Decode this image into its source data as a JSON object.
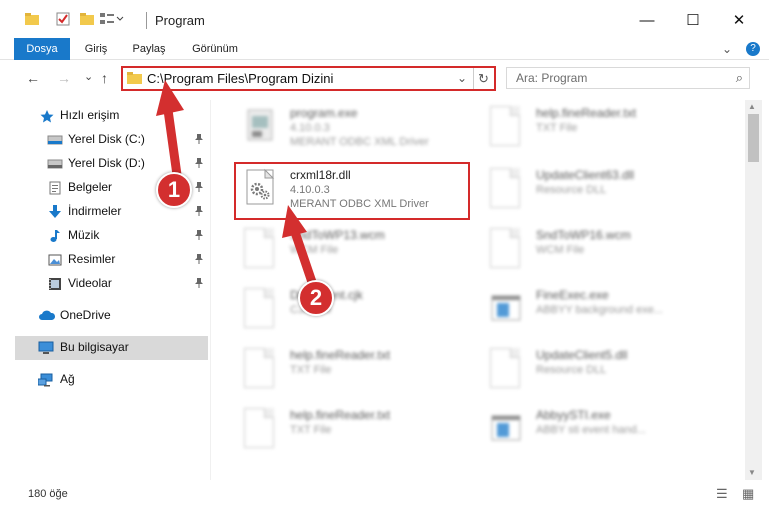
{
  "window": {
    "title": "Program",
    "minimize": "—",
    "maximize": "☐",
    "close": "✕"
  },
  "ribbon": {
    "tabs": [
      "Dosya",
      "Giriş",
      "Paylaş",
      "Görünüm"
    ],
    "expand": "⌄",
    "help": "?"
  },
  "nav": {
    "back": "←",
    "forward": "→",
    "recent": "⌄",
    "up": "↑"
  },
  "address": {
    "path": "C:\\Program Files\\Program Dizini",
    "dropdown": "⌄",
    "refresh": "↻"
  },
  "search": {
    "placeholder": "Ara: Program",
    "icon": "⌕"
  },
  "sidebar": {
    "items": [
      {
        "label": "Hızlı erişim",
        "icon": "star-icon",
        "pinned": false
      },
      {
        "label": "Yerel Disk (C:)",
        "icon": "drive-icon",
        "pinned": true
      },
      {
        "label": "Yerel Disk (D:)",
        "icon": "drive-icon",
        "pinned": true
      },
      {
        "label": "Belgeler",
        "icon": "documents-icon",
        "pinned": true
      },
      {
        "label": "İndirmeler",
        "icon": "download-icon",
        "pinned": true
      },
      {
        "label": "Müzik",
        "icon": "music-icon",
        "pinned": true
      },
      {
        "label": "Resimler",
        "icon": "pictures-icon",
        "pinned": true
      },
      {
        "label": "Videolar",
        "icon": "videos-icon",
        "pinned": true
      },
      {
        "label": "OneDrive",
        "icon": "cloud-icon",
        "pinned": false
      },
      {
        "label": "Bu bilgisayar",
        "icon": "computer-icon",
        "pinned": false
      },
      {
        "label": "Ağ",
        "icon": "network-icon",
        "pinned": false
      }
    ],
    "pin_glyph": "📌"
  },
  "files": [
    {
      "name": "program.exe",
      "meta1": "4.10.0.3",
      "meta2": "MERANT ODBC XML Driver",
      "icon": "exe-icon",
      "blurred": true
    },
    {
      "name": "help.fineReader.txt",
      "meta1": "TXT File",
      "meta2": "",
      "icon": "text-file-icon",
      "blurred": true
    },
    {
      "name": "crxml18r.dll",
      "meta1": "4.10.0.3",
      "meta2": "MERANT ODBC XML Driver",
      "icon": "dll-gear-icon",
      "blurred": false
    },
    {
      "name": "UpdateClient63.dll",
      "meta1": "Resource DLL",
      "meta2": "",
      "icon": "dll-gear-icon",
      "blurred": true
    },
    {
      "name": "SndToWP13.wcm",
      "meta1": "WCM File",
      "meta2": "",
      "icon": "file-icon",
      "blurred": true
    },
    {
      "name": "SndToWP16.wcm",
      "meta1": "WCM File",
      "meta2": "",
      "icon": "file-icon",
      "blurred": true
    },
    {
      "name": "Document.cjk",
      "meta1": "CJK File",
      "meta2": "",
      "icon": "file-icon",
      "blurred": true
    },
    {
      "name": "FineExec.exe",
      "meta1": "ABBYY background exe...",
      "meta2": "",
      "icon": "app-window-icon",
      "blurred": true
    },
    {
      "name": "help.fineReader.txt",
      "meta1": "TXT File",
      "meta2": "",
      "icon": "text-file-icon",
      "blurred": true
    },
    {
      "name": "UpdateClient5.dll",
      "meta1": "Resource DLL",
      "meta2": "",
      "icon": "dll-gear-icon",
      "blurred": true
    },
    {
      "name": "help.fineReader.txt",
      "meta1": "TXT File",
      "meta2": "",
      "icon": "text-file-icon",
      "blurred": true
    },
    {
      "name": "AbbyySTI.exe",
      "meta1": "ABBY sti event hand...",
      "meta2": "",
      "icon": "app-window-icon",
      "blurred": true
    }
  ],
  "status": {
    "count": "180 öğe",
    "details_view": "☰",
    "tiles_view": "▦"
  },
  "annotations": {
    "step1": "1",
    "step2": "2",
    "color": "#d32f2f"
  },
  "colors": {
    "accent": "#1979ca",
    "highlight": "#d42a2a",
    "selected": "#d9d9d9"
  }
}
